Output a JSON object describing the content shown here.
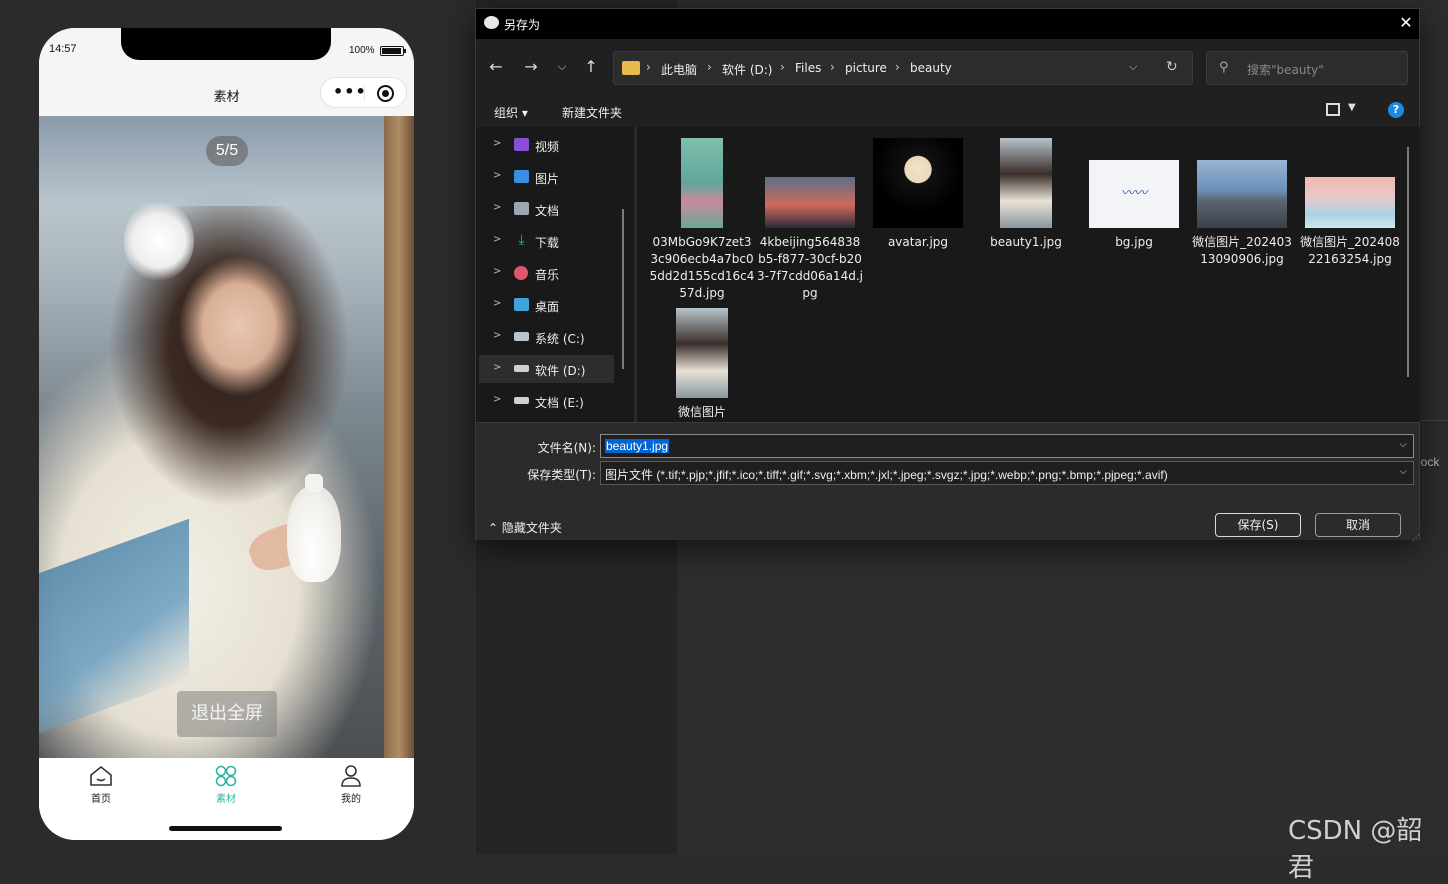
{
  "phone": {
    "time": "14:57",
    "battery": "100%",
    "nav_title": "素材",
    "counter": "5/5",
    "exit_fullscreen": "退出全屏",
    "tabs": [
      {
        "label": "首页",
        "icon": "home-icon",
        "active": false
      },
      {
        "label": "素材",
        "icon": "grid-icon",
        "active": true
      },
      {
        "label": "我的",
        "icon": "user-icon",
        "active": false
      }
    ],
    "accent": "#2bb5a0"
  },
  "dialog": {
    "title": "另存为",
    "close": "✕",
    "breadcrumb": [
      "此电脑",
      "软件 (D:)",
      "Files",
      "picture",
      "beauty"
    ],
    "search_placeholder": "搜索\"beauty\"",
    "toolbar": {
      "organize": "组织",
      "new_folder": "新建文件夹",
      "help": "?"
    },
    "tree": [
      {
        "label": "视频",
        "icon": "video-icon",
        "color": "#8a4fd8"
      },
      {
        "label": "图片",
        "icon": "image-icon",
        "color": "#3a8ee6"
      },
      {
        "label": "文档",
        "icon": "document-icon",
        "color": "#9aa7b5"
      },
      {
        "label": "下载",
        "icon": "download-icon",
        "color": "#2fb38a"
      },
      {
        "label": "音乐",
        "icon": "music-icon",
        "color": "#e0566a"
      },
      {
        "label": "桌面",
        "icon": "desktop-icon",
        "color": "#3fa3e0"
      },
      {
        "label": "系统 (C:)",
        "icon": "drive-c-icon",
        "color": "#b9c4cf"
      },
      {
        "label": "软件 (D:)",
        "icon": "drive-icon",
        "color": "#d0d0d0",
        "selected": true
      },
      {
        "label": "文档 (E:)",
        "icon": "drive-icon",
        "color": "#d0d0d0"
      }
    ],
    "files": [
      {
        "name": "03MbGo9K7zet33c906ecb4a7bc05dd2d155cd16c457d.jpg"
      },
      {
        "name": "4kbeijing564838b5-f877-30cf-b203-7f7cdd06a14d.jpg"
      },
      {
        "name": "avatar.jpg"
      },
      {
        "name": "beauty1.jpg"
      },
      {
        "name": "bg.jpg"
      },
      {
        "name": "微信图片_20240313090906.jpg"
      },
      {
        "name": "微信图片_20240822163254.jpg"
      },
      {
        "name": "微信图片"
      }
    ],
    "filename_label": "文件名(N):",
    "filename_value": "beauty1.jpg",
    "filetype_label": "保存类型(T):",
    "filetype_value": "图片文件 (*.tif;*.pjp;*.jfif;*.ico;*.tiff;*.gif;*.svg;*.xbm;*.jxl;*.jpeg;*.svgz;*.jpg;*.webp;*.png;*.bmp;*.pjpeg;*.avif)",
    "hide_folders": "隐藏文件夹",
    "save": "保存(S)",
    "cancel": "取消"
  },
  "side_text": "lock",
  "watermark": "CSDN @韶君"
}
